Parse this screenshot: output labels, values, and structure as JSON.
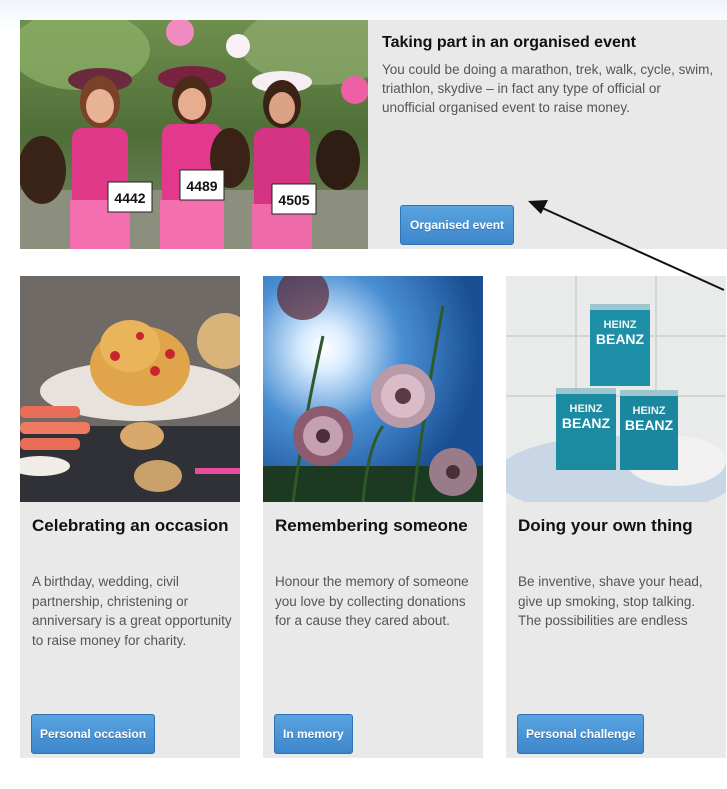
{
  "feature": {
    "title": "Taking part in an organised event",
    "text": "You could be doing a marathon, trek, walk, cycle, swim, triathlon, skydive – in fact any type of official or unofficial organised event to raise money.",
    "button_label": "Organised event",
    "bib_numbers": [
      "4442",
      "4489",
      "4505"
    ]
  },
  "cards": [
    {
      "title": "Celebrating an occasion",
      "text": "A birthday, wedding, civil partnership, christening or anniversary is a great opportunity to raise money for charity.",
      "button_label": "Personal occasion"
    },
    {
      "title": "Remembering someone",
      "text": "Honour the memory of someone you love by collecting donations for a cause they cared about.",
      "button_label": "In memory"
    },
    {
      "title": "Doing your own thing",
      "text": "Be inventive, shave your head, give up smoking, stop talking. The possibilities are endless",
      "button_label": "Personal challenge",
      "can_label_line1": "HEINZ",
      "can_label_line2": "BEANZ"
    }
  ],
  "colors": {
    "button": "#3d86cc",
    "card_background": "#e9e9e9"
  }
}
